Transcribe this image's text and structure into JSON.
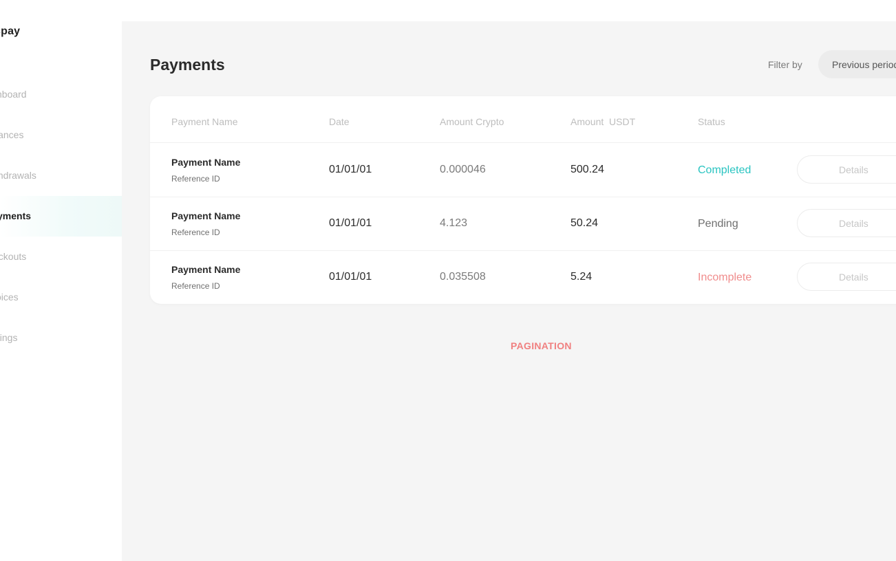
{
  "app": {
    "brand": "cpay"
  },
  "sidebar": {
    "items": [
      {
        "label": "shboard",
        "active": false
      },
      {
        "label": "lances",
        "active": false
      },
      {
        "label": "thdrawals",
        "active": false
      },
      {
        "label": "yments",
        "active": true
      },
      {
        "label": "eckouts",
        "active": false
      },
      {
        "label": "oices",
        "active": false
      },
      {
        "label": "ttings",
        "active": false
      }
    ]
  },
  "header": {
    "title": "Payments",
    "filter_label": "Filter by",
    "filter_value": "Previous period"
  },
  "table": {
    "columns": [
      "Payment Name",
      "Date",
      "Amount Crypto",
      "Amount  USDT",
      "Status"
    ],
    "rows": [
      {
        "name": "Payment Name",
        "reference": "Reference ID",
        "date": "01/01/01",
        "amount_crypto": "0.000046",
        "amount_usdt": "500.24",
        "status": "Completed",
        "status_type": "completed",
        "action": "Details"
      },
      {
        "name": "Payment Name",
        "reference": "Reference ID",
        "date": "01/01/01",
        "amount_crypto": "4.123",
        "amount_usdt": "50.24",
        "status": "Pending",
        "status_type": "pending",
        "action": "Details"
      },
      {
        "name": "Payment Name",
        "reference": "Reference ID",
        "date": "01/01/01",
        "amount_crypto": "0.035508",
        "amount_usdt": "5.24",
        "status": "Incomplete",
        "status_type": "incomplete",
        "action": "Details"
      }
    ]
  },
  "pagination": {
    "label": "PAGINATION"
  },
  "colors": {
    "completed": "#29c4c1",
    "pending": "#6f6f6f",
    "incomplete": "#f08c8c",
    "pagination": "#f08080"
  }
}
